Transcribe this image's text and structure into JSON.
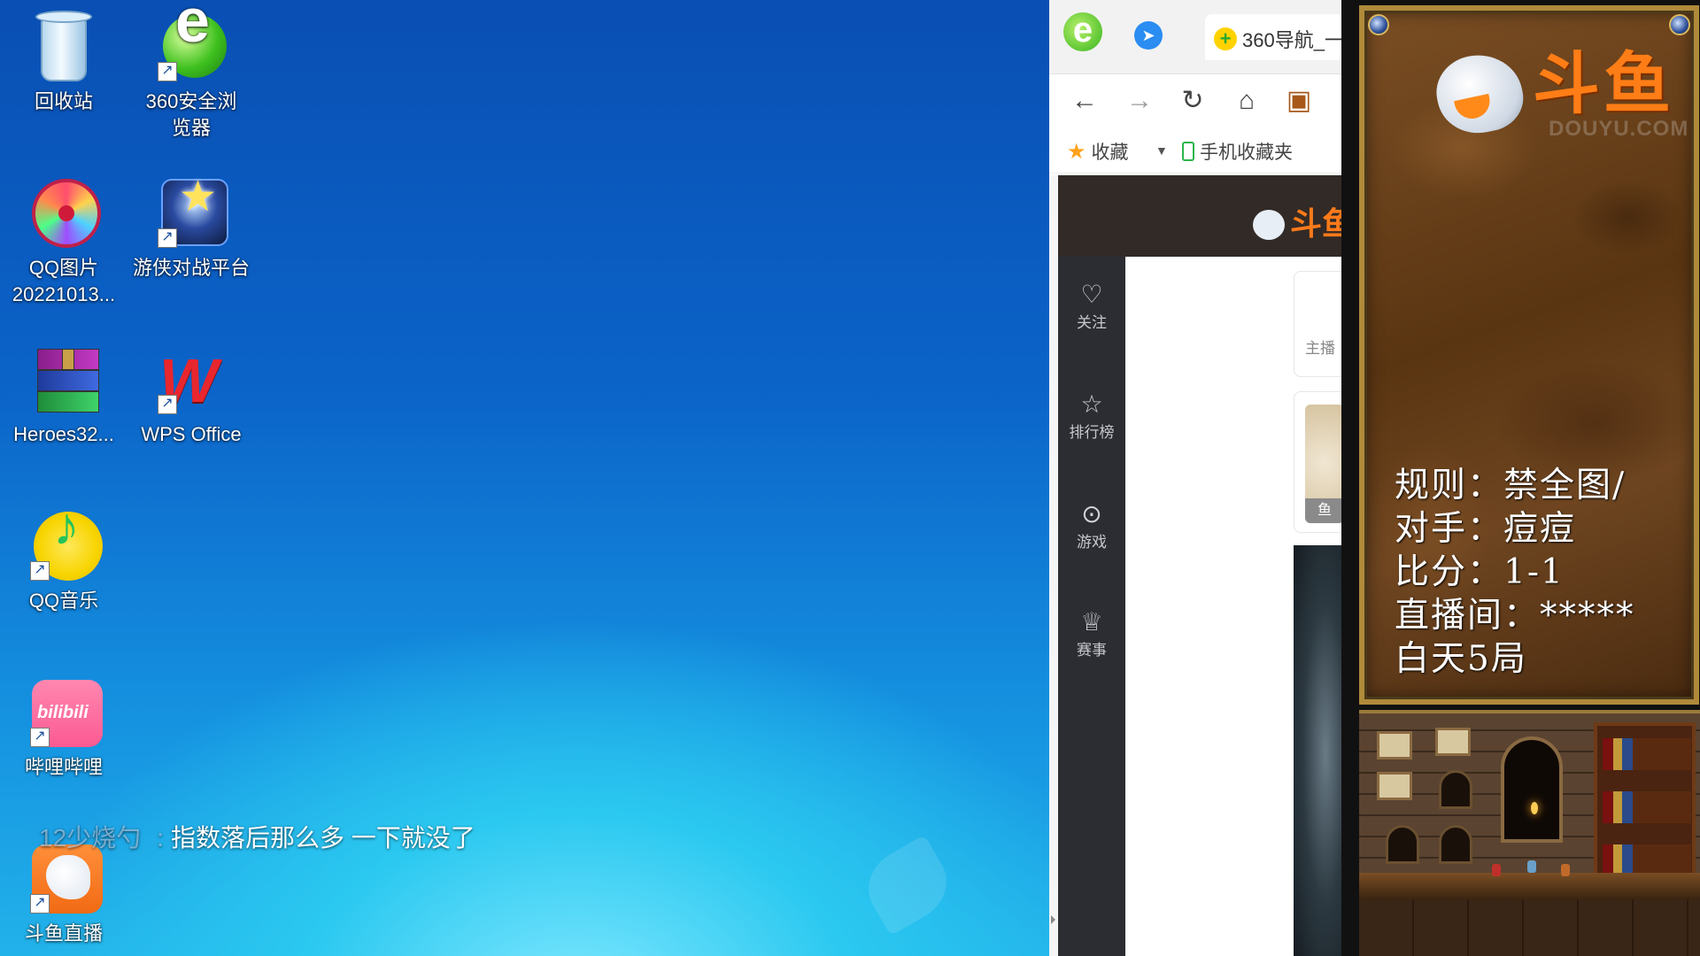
{
  "desktop": {
    "icons": [
      {
        "label": "回收站",
        "icon": "recycle-bin-icon"
      },
      {
        "label": "360安全浏览器",
        "icon": "browser-360-icon"
      },
      {
        "label": "QQ图片20221013...",
        "icon": "qq-image-icon"
      },
      {
        "label": "游侠对战平台",
        "icon": "game-platform-icon"
      },
      {
        "label": "Heroes32...",
        "icon": "winrar-archive-icon"
      },
      {
        "label": "WPS Office",
        "icon": "wps-office-icon"
      },
      {
        "label": "QQ音乐",
        "icon": "qq-music-icon"
      },
      {
        "label": "哔哩哔哩",
        "icon": "bilibili-icon"
      },
      {
        "label": "斗鱼直播",
        "icon": "douyu-icon"
      }
    ],
    "danmu": {
      "user": "12少烧勺",
      "separator": ":",
      "message": "指数落后那么多 一下就没了"
    }
  },
  "browser": {
    "tab_title": "360导航_一",
    "nav": {
      "back": "←",
      "forward": "→",
      "refresh": "↻",
      "home": "⌂",
      "extension": "▣"
    },
    "bookmarks": {
      "favorites": "收藏",
      "mobile_favorites": "手机收藏夹"
    },
    "douyu_page": {
      "logo": "斗鱼",
      "sidebar": [
        "关注",
        "排行榜",
        "游戏",
        "赛事"
      ],
      "card_text": "主播",
      "card_tag": "鱼"
    }
  },
  "stream_overlay": {
    "brand": "斗鱼",
    "domain": "DOUYU.COM",
    "rules": [
      "规则：禁全图/",
      "对手：痘痘",
      "比分：1-1",
      "直播间：*****",
      "白天5局"
    ]
  },
  "colors": {
    "douyu_orange": "#ff7d16",
    "douyu_header": "#322a26",
    "douyu_sidebar": "#2b2d33",
    "desktop_blue": "#0b63c8"
  }
}
